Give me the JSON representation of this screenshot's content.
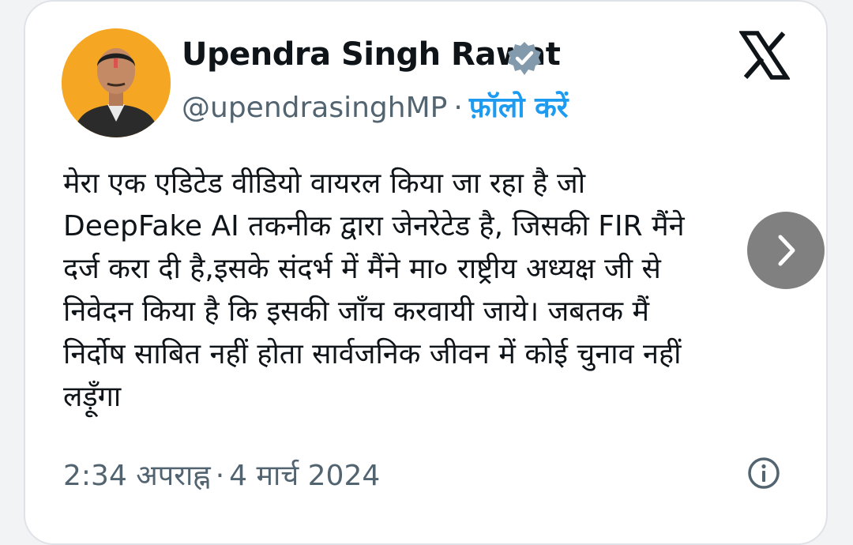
{
  "author": {
    "name": "Upendra Singh Rawat",
    "handle": "@upendrasinghMP",
    "separator": "·",
    "follow_label": "फ़ॉलो करें",
    "verified": true
  },
  "icons": {
    "verified": "verified-badge-icon",
    "logo": "x-logo-icon",
    "next": "chevron-right-icon",
    "info": "info-icon"
  },
  "tweet": {
    "lines": [
      "मेरा एक एडिटेड वीडियो वायरल किया जा रहा है जो",
      "DeepFake AI तकनीक द्वारा जेनरेटेड है, जिसकी FIR मैंने",
      "दर्ज करा दी है,इसके संदर्भ में मैंने मा० राष्ट्रीय अध्यक्ष जी से",
      "निवेदन किया है कि इसकी जाँच करवायी जाये। जबतक मैं",
      "निर्दोष साबित नहीं होता सार्वजनिक जीवन में कोई चुनाव नहीं",
      "लड़ूँगा"
    ]
  },
  "meta": {
    "time": "2:34 अपराह्न",
    "separator": "·",
    "date": "4 मार्च 2024"
  },
  "colors": {
    "accent": "#1d9bf0",
    "text": "#0f1419",
    "secondary": "#536471",
    "verified_badge": "#829aab",
    "avatar_bg": "#f5a623"
  }
}
